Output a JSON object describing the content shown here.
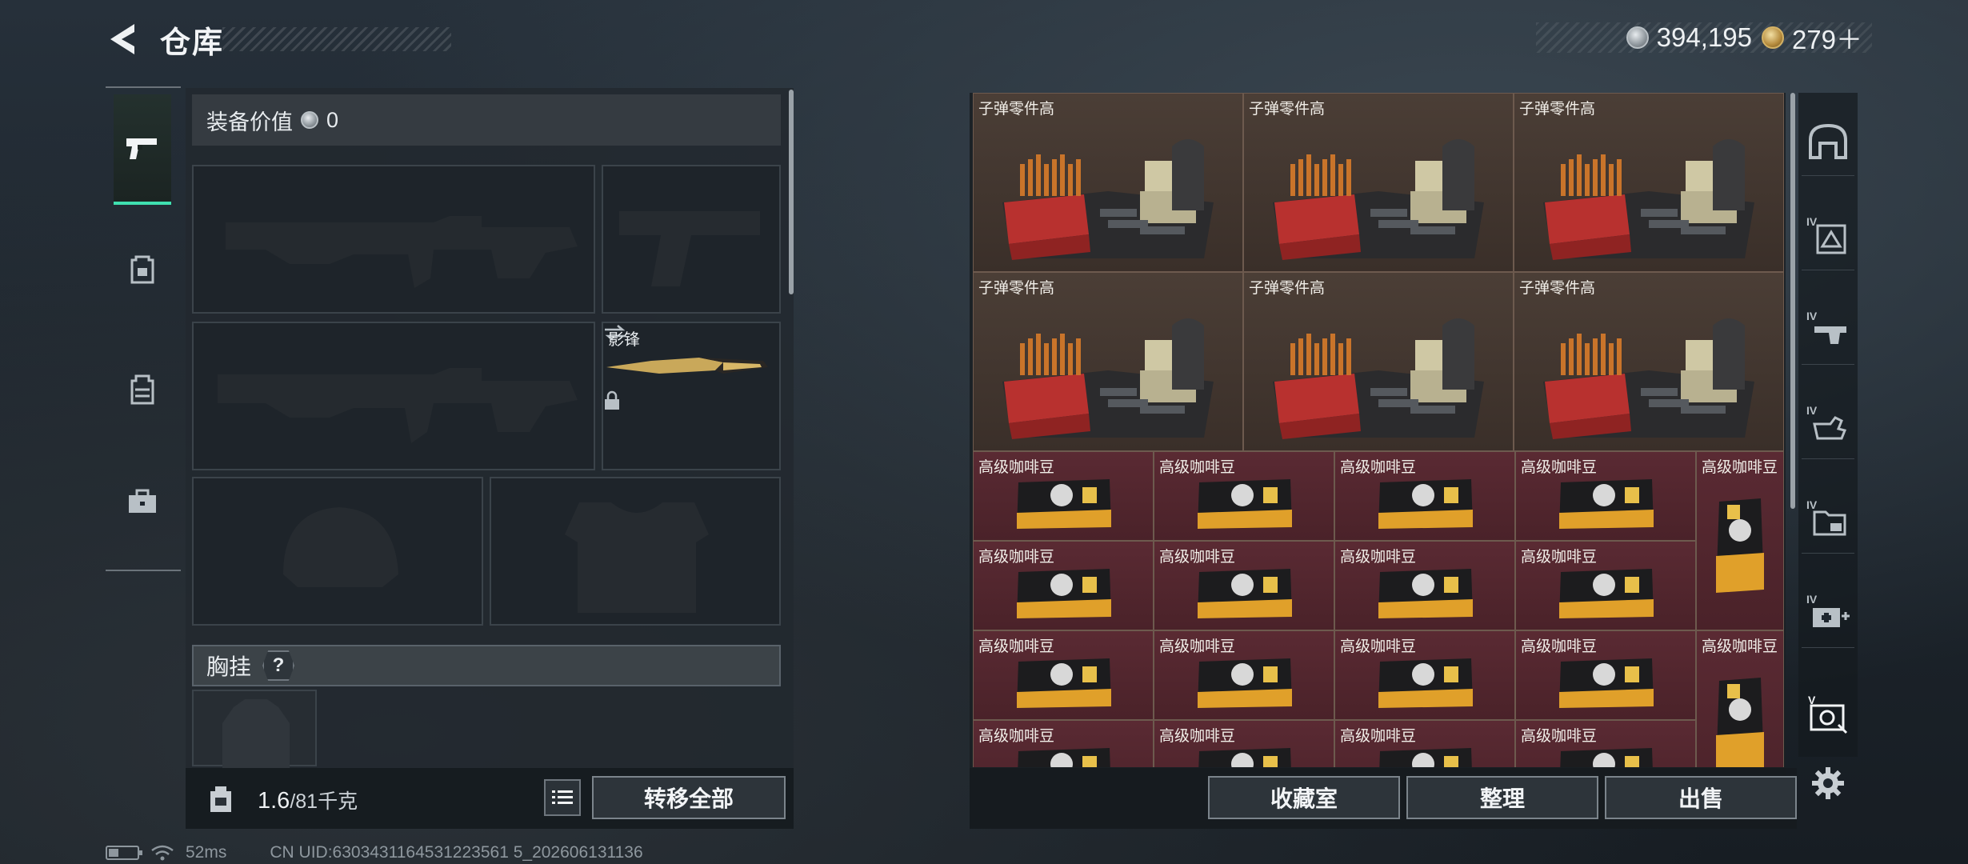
{
  "header": {
    "title": "仓库",
    "back_icon": "chevron-left-icon"
  },
  "currency": {
    "silver": "394,195",
    "gold": "279＋"
  },
  "sidebar": {
    "tabs": [
      {
        "name": "pistol-icon",
        "active": true
      },
      {
        "name": "backpack-icon",
        "active": false
      },
      {
        "name": "vest-icon",
        "active": false
      },
      {
        "name": "toolbox-icon",
        "active": false
      }
    ]
  },
  "equipment": {
    "value_label": "装备价值",
    "value": "0",
    "knife_label": "影锋",
    "chest_label": "胸挂",
    "help": "?"
  },
  "footer_left": {
    "weight": "1.6",
    "capacity": "/81",
    "unit": "千克",
    "transfer_all": "转移全部"
  },
  "grid": {
    "ammo_label": "子弹零件高",
    "coffee_label": "高级咖啡豆",
    "ammo_count": 6,
    "coffee_small_count": 16,
    "coffee_large_count": 2
  },
  "right_tabs": [
    {
      "name": "shelter-icon"
    },
    {
      "name": "cabinet-iv-icon",
      "badge": "IV"
    },
    {
      "name": "workbench-iv-icon",
      "badge": "IV"
    },
    {
      "name": "hand-iv-icon",
      "badge": "IV"
    },
    {
      "name": "folder-iv-icon",
      "badge": "IV"
    },
    {
      "name": "medkit-iv-icon",
      "badge": "IV"
    },
    {
      "name": "device-v-icon",
      "badge": "V"
    }
  ],
  "footer_right": {
    "favorites": "收藏室",
    "organize": "整理",
    "sell": "出售"
  },
  "status": {
    "ping": "52ms",
    "uid": "CN UID:6303431164531223561 5_202606131136"
  },
  "colors": {
    "accent": "#3fe0b0",
    "ammo_bg": "#4b3e36",
    "coffee_bg": "#5a2a33"
  }
}
